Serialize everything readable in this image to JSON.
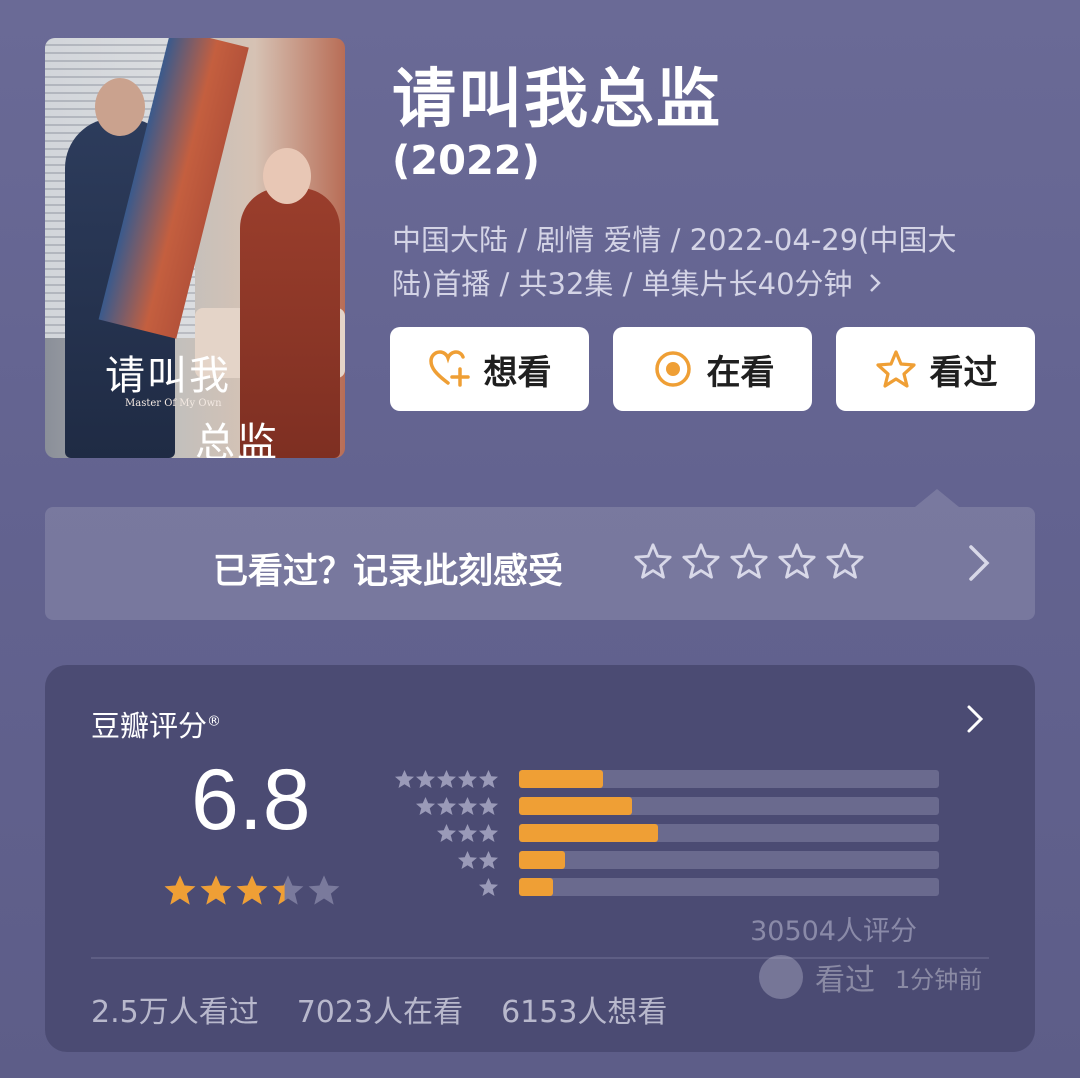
{
  "show": {
    "title": "请叫我总监",
    "year": "(2022)",
    "meta_line1": "中国大陆 / 剧情 爱情 / 2022-04-29(中国大",
    "meta_line2": "陆)首播 / 共32集 / 单集片长40分钟",
    "poster": {
      "title_top": "请叫我",
      "subtitle": "Master Of My Own",
      "title_bottom": "总监"
    }
  },
  "actions": {
    "want": "想看",
    "watching": "在看",
    "watched": "看过"
  },
  "rate_prompt": {
    "text": "已看过？记录此刻感受",
    "star_count": 5
  },
  "rating": {
    "label": "豆瓣评分",
    "registered": "®",
    "score": "6.8",
    "stars_value": 3.4,
    "distribution": [
      {
        "stars": 5,
        "fraction": 0.2
      },
      {
        "stars": 4,
        "fraction": 0.27
      },
      {
        "stars": 3,
        "fraction": 0.33
      },
      {
        "stars": 2,
        "fraction": 0.11
      },
      {
        "stars": 1,
        "fraction": 0.08
      }
    ],
    "count": "30504人评分",
    "stats": {
      "watched": "2.5万人看过",
      "watching": "7023人在看",
      "want": "6153人想看"
    },
    "toast": {
      "action": "看过",
      "time": "1分钟前"
    }
  },
  "colors": {
    "accent": "#ef9f35",
    "background": "#65658f",
    "card": "#4b4b73"
  }
}
